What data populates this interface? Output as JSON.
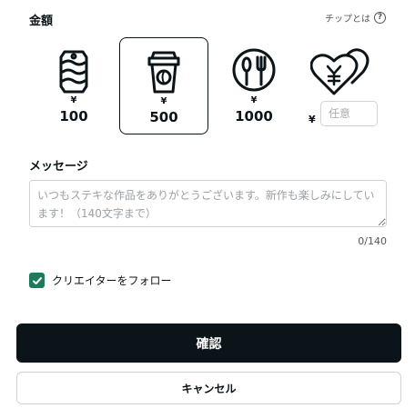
{
  "amount_section": {
    "label": "金額",
    "tip_help_label": "チップとは",
    "help_icon_glyph": "?"
  },
  "tip_options": [
    {
      "icon": "can-icon",
      "currency": "¥",
      "amount": "100",
      "selected": false
    },
    {
      "icon": "coffee-cup-icon",
      "currency": "¥",
      "amount": "500",
      "selected": true
    },
    {
      "icon": "meal-icon",
      "currency": "¥",
      "amount": "1000",
      "selected": false
    }
  ],
  "custom_amount": {
    "icon": "yen-hearts-icon",
    "currency": "¥",
    "placeholder": "任意"
  },
  "message_section": {
    "label": "メッセージ",
    "placeholder": "いつもステキな作品をありがとうございます。新作も楽しみにしています！（140文字まで）",
    "char_count": "0/140"
  },
  "follow": {
    "label": "クリエイターをフォロー",
    "checked": true
  },
  "actions": {
    "confirm_label": "確認",
    "cancel_label": "キャンセル"
  },
  "colors": {
    "primary": "#0b1418",
    "checkbox": "#1f7a5c",
    "border": "#cfd3d6"
  }
}
